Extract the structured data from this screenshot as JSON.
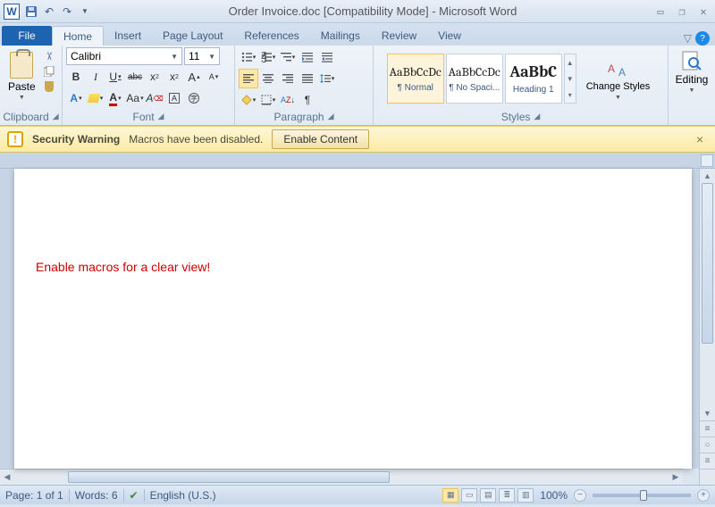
{
  "title": "Order Invoice.doc [Compatibility Mode] - Microsoft Word",
  "tabs": {
    "file": "File",
    "items": [
      "Home",
      "Insert",
      "Page Layout",
      "References",
      "Mailings",
      "Review",
      "View"
    ],
    "active": 0
  },
  "ribbon": {
    "clipboard": {
      "label": "Clipboard",
      "paste": "Paste"
    },
    "font": {
      "label": "Font",
      "name": "Calibri",
      "size": "11",
      "bold": "B",
      "italic": "I",
      "underline": "U",
      "strike": "abc",
      "sub": "x",
      "sup": "x",
      "grow": "A",
      "shrink": "A",
      "case": "Aa",
      "clear": "A",
      "color": "A",
      "highlight": "ab",
      "effects": "A"
    },
    "paragraph": {
      "label": "Paragraph"
    },
    "styles": {
      "label": "Styles",
      "items": [
        {
          "preview": "AaBbCcDc",
          "name": "¶ Normal"
        },
        {
          "preview": "AaBbCcDc",
          "name": "¶ No Spaci..."
        },
        {
          "preview": "AaBbC",
          "name": "Heading 1"
        }
      ],
      "change": "Change Styles"
    },
    "editing": {
      "label": "Editing"
    }
  },
  "security": {
    "title": "Security Warning",
    "text": "Macros have been disabled.",
    "button": "Enable Content"
  },
  "document": {
    "body": "Enable macros for a clear view!"
  },
  "status": {
    "page": "Page: 1 of 1",
    "words": "Words: 6",
    "lang": "English (U.S.)",
    "zoom": "100%"
  }
}
